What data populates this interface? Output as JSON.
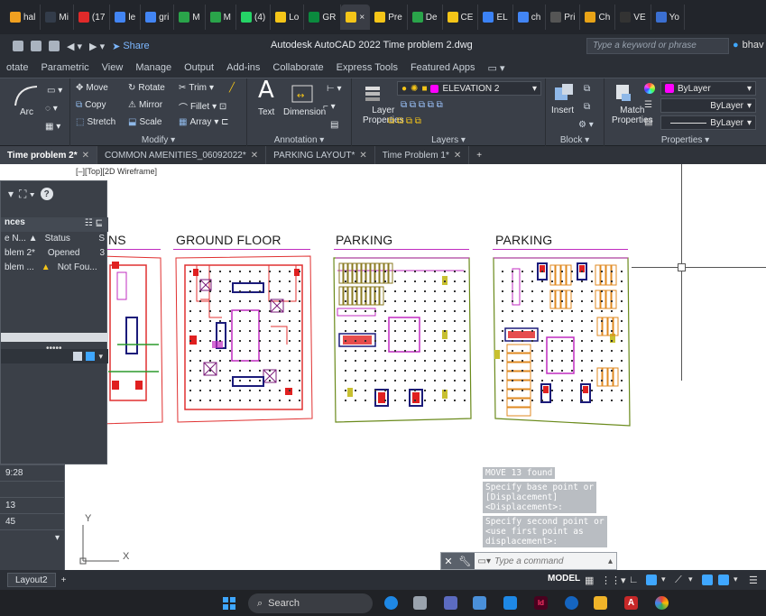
{
  "browser_tabs": [
    {
      "label": "hal",
      "color": "#f0a020"
    },
    {
      "label": "Mi",
      "color": "#333c4a"
    },
    {
      "label": "(17",
      "color": "#e02a2a"
    },
    {
      "label": "le",
      "color": "#4285f4"
    },
    {
      "label": "gri",
      "color": "#4285f4"
    },
    {
      "label": "M",
      "color": "#2aa44a"
    },
    {
      "label": "M",
      "color": "#2aa44a"
    },
    {
      "label": "(4)",
      "color": "#25d366"
    },
    {
      "label": "Lo",
      "color": "#f5c518"
    },
    {
      "label": "GR",
      "color": "#0b8a3e"
    },
    {
      "label": "×",
      "color": "#f5c518"
    },
    {
      "label": "Pre",
      "color": "#f5c518"
    },
    {
      "label": "De",
      "color": "#2aa44a"
    },
    {
      "label": "CE",
      "color": "#f5c518"
    },
    {
      "label": "EL",
      "color": "#3b82f6"
    },
    {
      "label": "ch",
      "color": "#4285f4"
    },
    {
      "label": "Pri",
      "color": "#555555"
    },
    {
      "label": "Ch",
      "color": "#e8a317"
    },
    {
      "label": "VE",
      "color": "#333333"
    },
    {
      "label": "Yo",
      "color": "#3b6fd1"
    }
  ],
  "title_bar": {
    "share": "Share",
    "title": "Autodesk AutoCAD 2022   Time problem 2.dwg",
    "search_placeholder": "Type a keyword or phrase",
    "user": "bhav"
  },
  "ribbon_tabs": [
    "otate",
    "Parametric",
    "View",
    "Manage",
    "Output",
    "Add-ins",
    "Collaborate",
    "Express Tools",
    "Featured Apps"
  ],
  "ribbon": {
    "draw": {
      "arc": "Arc"
    },
    "modify": {
      "title": "Modify ▾",
      "move": "Move",
      "rotate": "Rotate",
      "trim": "Trim",
      "copy": "Copy",
      "mirror": "Mirror",
      "fillet": "Fillet",
      "stretch": "Stretch",
      "scale": "Scale",
      "array": "Array"
    },
    "annotation": {
      "title": "Annotation ▾",
      "text": "Text",
      "dimension": "Dimension"
    },
    "layers": {
      "title": "Layers ▾",
      "layer_name": "ELEVATION 2",
      "layer_properties_1": "Layer",
      "layer_properties_2": "Properties"
    },
    "block": {
      "title": "Block ▾",
      "insert": "Insert"
    },
    "properties": {
      "title": "Properties ▾",
      "match_1": "Match",
      "match_2": "Properties",
      "color": "ByLayer",
      "linetype": "ByLayer",
      "lineweight": "ByLayer"
    }
  },
  "doc_tabs": [
    {
      "label": "Time problem 2*",
      "active": true
    },
    {
      "label": "COMMON AMENITIES_06092022*",
      "active": false
    },
    {
      "label": "PARKING LAYOUT*",
      "active": false
    },
    {
      "label": "Time Problem 1*",
      "active": false
    }
  ],
  "canvas": {
    "view_label": "[–][Top][2D Wireframe]",
    "plans": [
      {
        "title": "NS"
      },
      {
        "title": "GROUND FLOOR"
      },
      {
        "title": "PARKING"
      },
      {
        "title": "PARKING"
      }
    ]
  },
  "palette": {
    "header": "nces",
    "col_name": "e N... ▲",
    "col_status": "Status",
    "col_extra": "S",
    "rows": [
      {
        "name": "blem 2*",
        "status": "Opened",
        "extra": "3"
      },
      {
        "name": "blem ...",
        "status": "Not Fou..."
      }
    ]
  },
  "left_strip": [
    "9:28",
    "",
    "13",
    "45"
  ],
  "command": {
    "history": [
      "MOVE 13 found",
      "Specify base point or\n[Displacement]\n<Displacement>:",
      "Specify second point or\n<use first point as\ndisplacement>:"
    ],
    "placeholder": "Type a command"
  },
  "status_bar": {
    "layout": "Layout2",
    "model": "MODEL"
  },
  "taskbar": {
    "search": "Search"
  }
}
